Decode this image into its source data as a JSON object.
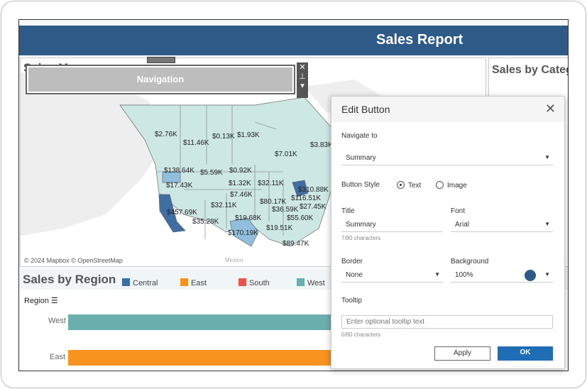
{
  "header": {
    "title": "Sales Report"
  },
  "map": {
    "title": "Sales Map",
    "attribution": "© 2024 Mapbox © OpenStreetMap",
    "place_label": "Mexico",
    "labels": [
      "$2.76K",
      "$11.46K",
      "$0.13K",
      "$1.93K",
      "$7.01K",
      "$3.83K",
      "$138.64K",
      "$5.59K",
      "$0.92K",
      "$17.43K",
      "$1.32K",
      "$32.11K",
      "$310.88K",
      "$7.46K",
      "$80.17K",
      "$116.51K",
      "$32.11K",
      "$36.59K",
      "$27.45K",
      "$457.69K",
      "$19.68K",
      "$55.60K",
      "$35.28K",
      "$19.51K",
      "$170.19K",
      "$89.47K"
    ],
    "colors": {
      "low": "#cde7e4",
      "mid": "#8fbfdc",
      "high": "#3f6ea3"
    }
  },
  "navigation_button": {
    "label": "Navigation",
    "controls": [
      "close-icon",
      "pin-icon",
      "more-icon"
    ]
  },
  "category": {
    "title": "Sales by Category"
  },
  "region": {
    "title": "Sales by Region",
    "field": "Region",
    "legend": [
      {
        "name": "Central",
        "color": "#3b6ea8"
      },
      {
        "name": "East",
        "color": "#f7931e"
      },
      {
        "name": "South",
        "color": "#e8554e"
      },
      {
        "name": "West",
        "color": "#6aafad"
      }
    ],
    "bars": [
      {
        "label": "West",
        "color": "#6aafad"
      },
      {
        "label": "East",
        "color": "#f7931e"
      }
    ]
  },
  "dialog": {
    "title": "Edit Button",
    "navigate_label": "Navigate to",
    "navigate_value": "Summary",
    "style_label": "Button Style",
    "style_options": [
      "Text",
      "Image"
    ],
    "style_selected": "Text",
    "title_label": "Title",
    "title_value": "Summary",
    "title_count": "7/80 characters",
    "font_label": "Font",
    "font_value": "Arial",
    "border_label": "Border",
    "border_value": "None",
    "background_label": "Background",
    "background_value": "100%",
    "background_color": "#2e5a87",
    "tooltip_label": "Tooltip",
    "tooltip_placeholder": "Enter optional tooltip text",
    "tooltip_count": "0/80 characters",
    "apply": "Apply",
    "ok": "OK"
  }
}
